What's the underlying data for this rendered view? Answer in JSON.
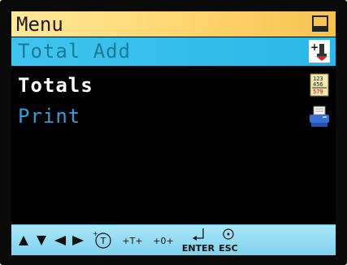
{
  "header": {
    "title": "Menu",
    "icon": "window-icon"
  },
  "menu": {
    "items": [
      {
        "label": "Total Add",
        "icon": "total-add-icon",
        "selected": true
      },
      {
        "label": "Totals",
        "icon": "calculator-totals-icon"
      },
      {
        "label": "Print",
        "icon": "printer-icon"
      }
    ]
  },
  "footer": {
    "keys": [
      {
        "icon": "arrow-up-icon"
      },
      {
        "icon": "arrow-down-icon"
      },
      {
        "icon": "arrow-left-icon"
      },
      {
        "icon": "arrow-right-icon"
      },
      {
        "icon": "total-key-icon",
        "label": "T"
      },
      {
        "icon": "plus-t-plus-icon",
        "label": "+T+"
      },
      {
        "icon": "plus-zero-plus-icon",
        "label": "+0+"
      },
      {
        "icon": "enter-icon",
        "label": "ENTER"
      },
      {
        "icon": "esc-icon",
        "label": "ESC"
      }
    ]
  },
  "colors": {
    "title_bar": "#ffd36a",
    "selected_row": "#2ab8e8",
    "screen_bg": "#000000",
    "footer_bg": "#8fd9f1"
  }
}
